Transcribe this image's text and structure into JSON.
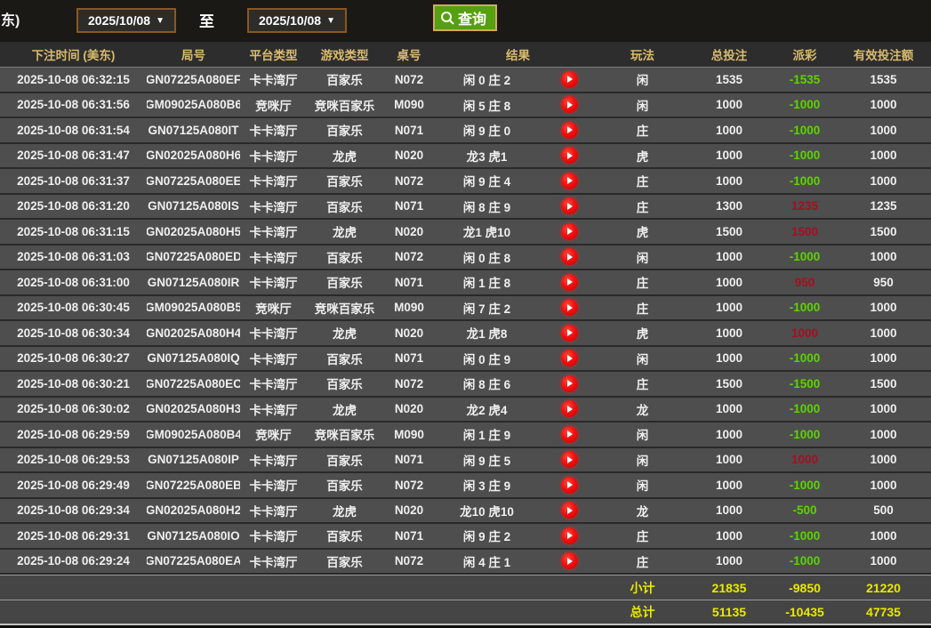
{
  "toolbar": {
    "clipped_label": "东)",
    "date_from": "2025/10/08",
    "to_label": "至",
    "date_to": "2025/10/08",
    "query_label": "查询"
  },
  "table": {
    "headers": [
      "下注时间 (美东)",
      "局号",
      "平台类型",
      "游戏类型",
      "桌号",
      "结果",
      "玩法",
      "总投注",
      "派彩",
      "有效投注额"
    ],
    "rows": [
      {
        "time": "2025-10-08 06:32:15",
        "round": "GN07225A080EF",
        "platform": "卡卡湾厅",
        "game": "百家乐",
        "table": "N072",
        "result": "闲 0 庄 2",
        "play": "闲",
        "total_bet": "1535",
        "payout": "-1535",
        "valid_bet": "1535"
      },
      {
        "time": "2025-10-08 06:31:56",
        "round": "GM09025A080B6",
        "platform": "竞咪厅",
        "game": "竞咪百家乐",
        "table": "M090",
        "result": "闲 5 庄 8",
        "play": "闲",
        "total_bet": "1000",
        "payout": "-1000",
        "valid_bet": "1000"
      },
      {
        "time": "2025-10-08 06:31:54",
        "round": "GN07125A080IT",
        "platform": "卡卡湾厅",
        "game": "百家乐",
        "table": "N071",
        "result": "闲 9 庄 0",
        "play": "庄",
        "total_bet": "1000",
        "payout": "-1000",
        "valid_bet": "1000"
      },
      {
        "time": "2025-10-08 06:31:47",
        "round": "GN02025A080H6",
        "platform": "卡卡湾厅",
        "game": "龙虎",
        "table": "N020",
        "result": "龙3 虎1",
        "play": "虎",
        "total_bet": "1000",
        "payout": "-1000",
        "valid_bet": "1000"
      },
      {
        "time": "2025-10-08 06:31:37",
        "round": "GN07225A080EE",
        "platform": "卡卡湾厅",
        "game": "百家乐",
        "table": "N072",
        "result": "闲 9 庄 4",
        "play": "庄",
        "total_bet": "1000",
        "payout": "-1000",
        "valid_bet": "1000"
      },
      {
        "time": "2025-10-08 06:31:20",
        "round": "GN07125A080IS",
        "platform": "卡卡湾厅",
        "game": "百家乐",
        "table": "N071",
        "result": "闲 8 庄 9",
        "play": "庄",
        "total_bet": "1300",
        "payout": "1235",
        "valid_bet": "1235"
      },
      {
        "time": "2025-10-08 06:31:15",
        "round": "GN02025A080H5",
        "platform": "卡卡湾厅",
        "game": "龙虎",
        "table": "N020",
        "result": "龙1 虎10",
        "play": "虎",
        "total_bet": "1500",
        "payout": "1500",
        "valid_bet": "1500"
      },
      {
        "time": "2025-10-08 06:31:03",
        "round": "GN07225A080ED",
        "platform": "卡卡湾厅",
        "game": "百家乐",
        "table": "N072",
        "result": "闲 0 庄 8",
        "play": "闲",
        "total_bet": "1000",
        "payout": "-1000",
        "valid_bet": "1000"
      },
      {
        "time": "2025-10-08 06:31:00",
        "round": "GN07125A080IR",
        "platform": "卡卡湾厅",
        "game": "百家乐",
        "table": "N071",
        "result": "闲 1 庄 8",
        "play": "庄",
        "total_bet": "1000",
        "payout": "950",
        "valid_bet": "950"
      },
      {
        "time": "2025-10-08 06:30:45",
        "round": "GM09025A080B5",
        "platform": "竞咪厅",
        "game": "竞咪百家乐",
        "table": "M090",
        "result": "闲 7 庄 2",
        "play": "庄",
        "total_bet": "1000",
        "payout": "-1000",
        "valid_bet": "1000"
      },
      {
        "time": "2025-10-08 06:30:34",
        "round": "GN02025A080H4",
        "platform": "卡卡湾厅",
        "game": "龙虎",
        "table": "N020",
        "result": "龙1 虎8",
        "play": "虎",
        "total_bet": "1000",
        "payout": "1000",
        "valid_bet": "1000"
      },
      {
        "time": "2025-10-08 06:30:27",
        "round": "GN07125A080IQ",
        "platform": "卡卡湾厅",
        "game": "百家乐",
        "table": "N071",
        "result": "闲 0 庄 9",
        "play": "闲",
        "total_bet": "1000",
        "payout": "-1000",
        "valid_bet": "1000"
      },
      {
        "time": "2025-10-08 06:30:21",
        "round": "GN07225A080EC",
        "platform": "卡卡湾厅",
        "game": "百家乐",
        "table": "N072",
        "result": "闲 8 庄 6",
        "play": "庄",
        "total_bet": "1500",
        "payout": "-1500",
        "valid_bet": "1500"
      },
      {
        "time": "2025-10-08 06:30:02",
        "round": "GN02025A080H3",
        "platform": "卡卡湾厅",
        "game": "龙虎",
        "table": "N020",
        "result": "龙2 虎4",
        "play": "龙",
        "total_bet": "1000",
        "payout": "-1000",
        "valid_bet": "1000"
      },
      {
        "time": "2025-10-08 06:29:59",
        "round": "GM09025A080B4",
        "platform": "竞咪厅",
        "game": "竞咪百家乐",
        "table": "M090",
        "result": "闲 1 庄 9",
        "play": "闲",
        "total_bet": "1000",
        "payout": "-1000",
        "valid_bet": "1000"
      },
      {
        "time": "2025-10-08 06:29:53",
        "round": "GN07125A080IP",
        "platform": "卡卡湾厅",
        "game": "百家乐",
        "table": "N071",
        "result": "闲 9 庄 5",
        "play": "闲",
        "total_bet": "1000",
        "payout": "1000",
        "valid_bet": "1000"
      },
      {
        "time": "2025-10-08 06:29:49",
        "round": "GN07225A080EB",
        "platform": "卡卡湾厅",
        "game": "百家乐",
        "table": "N072",
        "result": "闲 3 庄 9",
        "play": "闲",
        "total_bet": "1000",
        "payout": "-1000",
        "valid_bet": "1000"
      },
      {
        "time": "2025-10-08 06:29:34",
        "round": "GN02025A080H2",
        "platform": "卡卡湾厅",
        "game": "龙虎",
        "table": "N020",
        "result": "龙10 虎10",
        "play": "龙",
        "total_bet": "1000",
        "payout": "-500",
        "valid_bet": "500"
      },
      {
        "time": "2025-10-08 06:29:31",
        "round": "GN07125A080IO",
        "platform": "卡卡湾厅",
        "game": "百家乐",
        "table": "N071",
        "result": "闲 9 庄 2",
        "play": "庄",
        "total_bet": "1000",
        "payout": "-1000",
        "valid_bet": "1000"
      },
      {
        "time": "2025-10-08 06:29:24",
        "round": "GN07225A080EA",
        "platform": "卡卡湾厅",
        "game": "百家乐",
        "table": "N072",
        "result": "闲 4 庄 1",
        "play": "庄",
        "total_bet": "1000",
        "payout": "-1000",
        "valid_bet": "1000"
      }
    ],
    "subtotal": {
      "label": "小计",
      "total_bet": "21835",
      "payout": "-9850",
      "valid_bet": "21220"
    },
    "grand_total": {
      "label": "总计",
      "total_bet": "51135",
      "payout": "-10435",
      "valid_bet": "47735"
    }
  },
  "colors": {
    "payout_negative_green": "#5bd400",
    "payout_positive_red": "#a3101f",
    "header_gold": "#d9ba6e",
    "totals_yellow": "#e9e900",
    "query_button_green": "#55a00f",
    "picker_border_brown": "#8a5722",
    "button_border_tan": "#d2a964",
    "row_background": "#4e4e4e"
  }
}
